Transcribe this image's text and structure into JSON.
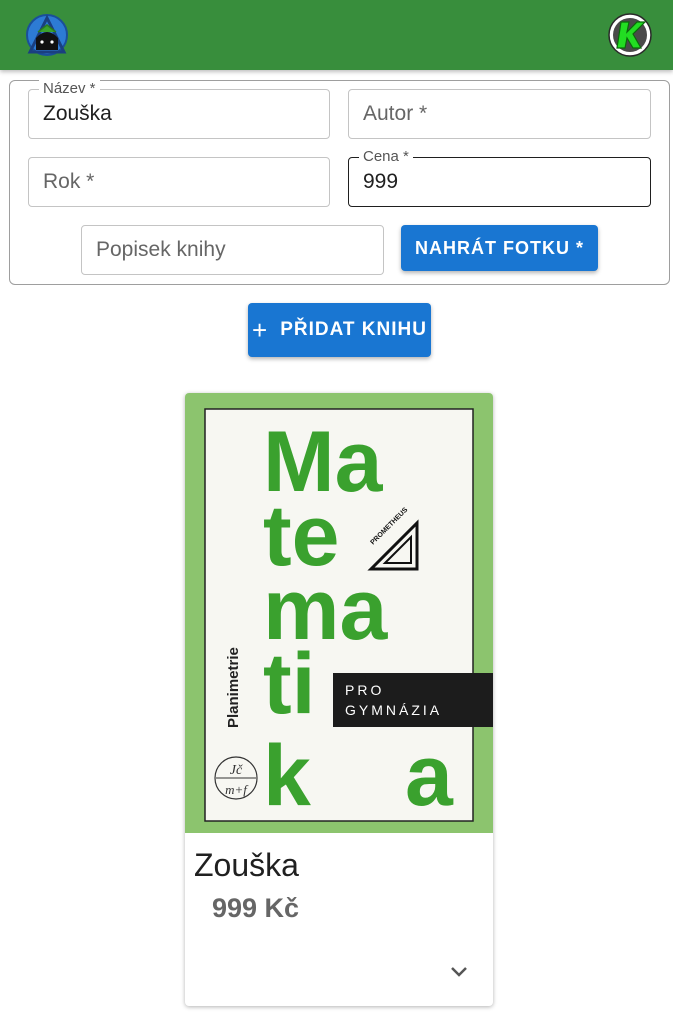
{
  "header": {
    "logo_icon": "school-logo-icon",
    "avatar_icon": "user-avatar-icon",
    "avatar_letter": "K"
  },
  "form": {
    "nazev": {
      "label": "Název *",
      "value": "Zouška"
    },
    "autor": {
      "placeholder": "Autor *",
      "value": ""
    },
    "rok": {
      "placeholder": "Rok *",
      "value": ""
    },
    "cena": {
      "label": "Cena *",
      "value": "999"
    },
    "popisek": {
      "placeholder": "Popisek knihy",
      "value": ""
    },
    "upload_label": "NAHRÁT FOTKU *"
  },
  "add_button": {
    "icon": "plus-icon",
    "label": "PŘIDAT KNIHU"
  },
  "book": {
    "title": "Zouška",
    "price": "999 Kč",
    "cover": {
      "letters": [
        "Ma",
        "te",
        "ma",
        "ti",
        "k",
        "a"
      ],
      "side_text": "Planimetrie",
      "badge_line1": "PRO",
      "badge_line2": "GYMNÁZIA",
      "publisher": "PROMETHEUS",
      "seal_top": "Jč",
      "seal_bottom": "m+f"
    },
    "expand_icon": "chevron-down-icon"
  },
  "colors": {
    "appbar": "#388e3c",
    "primary": "#1976d2",
    "cover_green": "#3aa12e",
    "cover_bg": "#8cc46e"
  }
}
